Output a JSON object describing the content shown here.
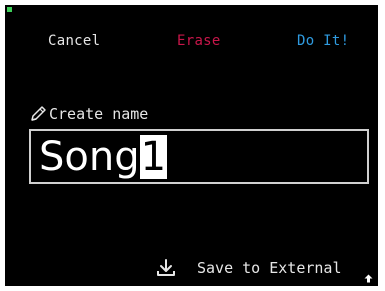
{
  "header": {
    "cancel_label": "Cancel",
    "erase_label": "Erase",
    "do_it_label": "Do It!"
  },
  "form": {
    "label": "Create name",
    "name_value": "Song",
    "cursor_char": "1"
  },
  "footer": {
    "save_label": "Save to External"
  },
  "colors": {
    "background": "#000000",
    "text": "#e6e6e6",
    "erase": "#c8164a",
    "do_it": "#2f9be0",
    "indicator": "#3ecf5a",
    "field_border": "#d0d0d0"
  },
  "icons": {
    "label_icon": "pencil-icon",
    "save_icon": "download-icon",
    "scroll_icon": "arrow-up-icon"
  }
}
